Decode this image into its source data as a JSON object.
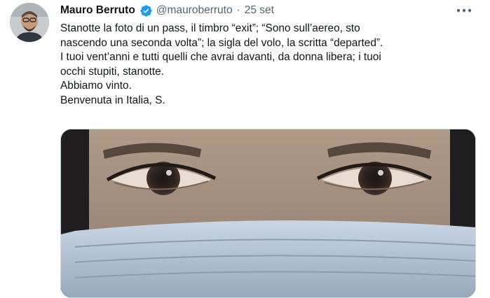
{
  "tweet": {
    "author_name": "Mauro Berruto",
    "handle": "@mauroberruto",
    "separator": "·",
    "date": "25 set",
    "text_lines": [
      "Stanotte la foto di un pass, il timbro “exit”; “Sono sull’aereo, sto",
      "nascendo una seconda volta”; la sigla del volo, la scritta “departed”.",
      "I tuoi vent’anni e tutti quelli che avrai davanti, da donna libera; i tuoi",
      "occhi stupiti, stanotte.",
      "Abbiamo vinto.",
      "Benvenuta in Italia, S."
    ]
  },
  "icons": {
    "verified": "verified-badge-icon",
    "more": "more-options-icon"
  },
  "colors": {
    "name": "#0f1419",
    "secondary": "#536471",
    "verified": "#1d9bf0",
    "media_border": "#cfd9de"
  }
}
